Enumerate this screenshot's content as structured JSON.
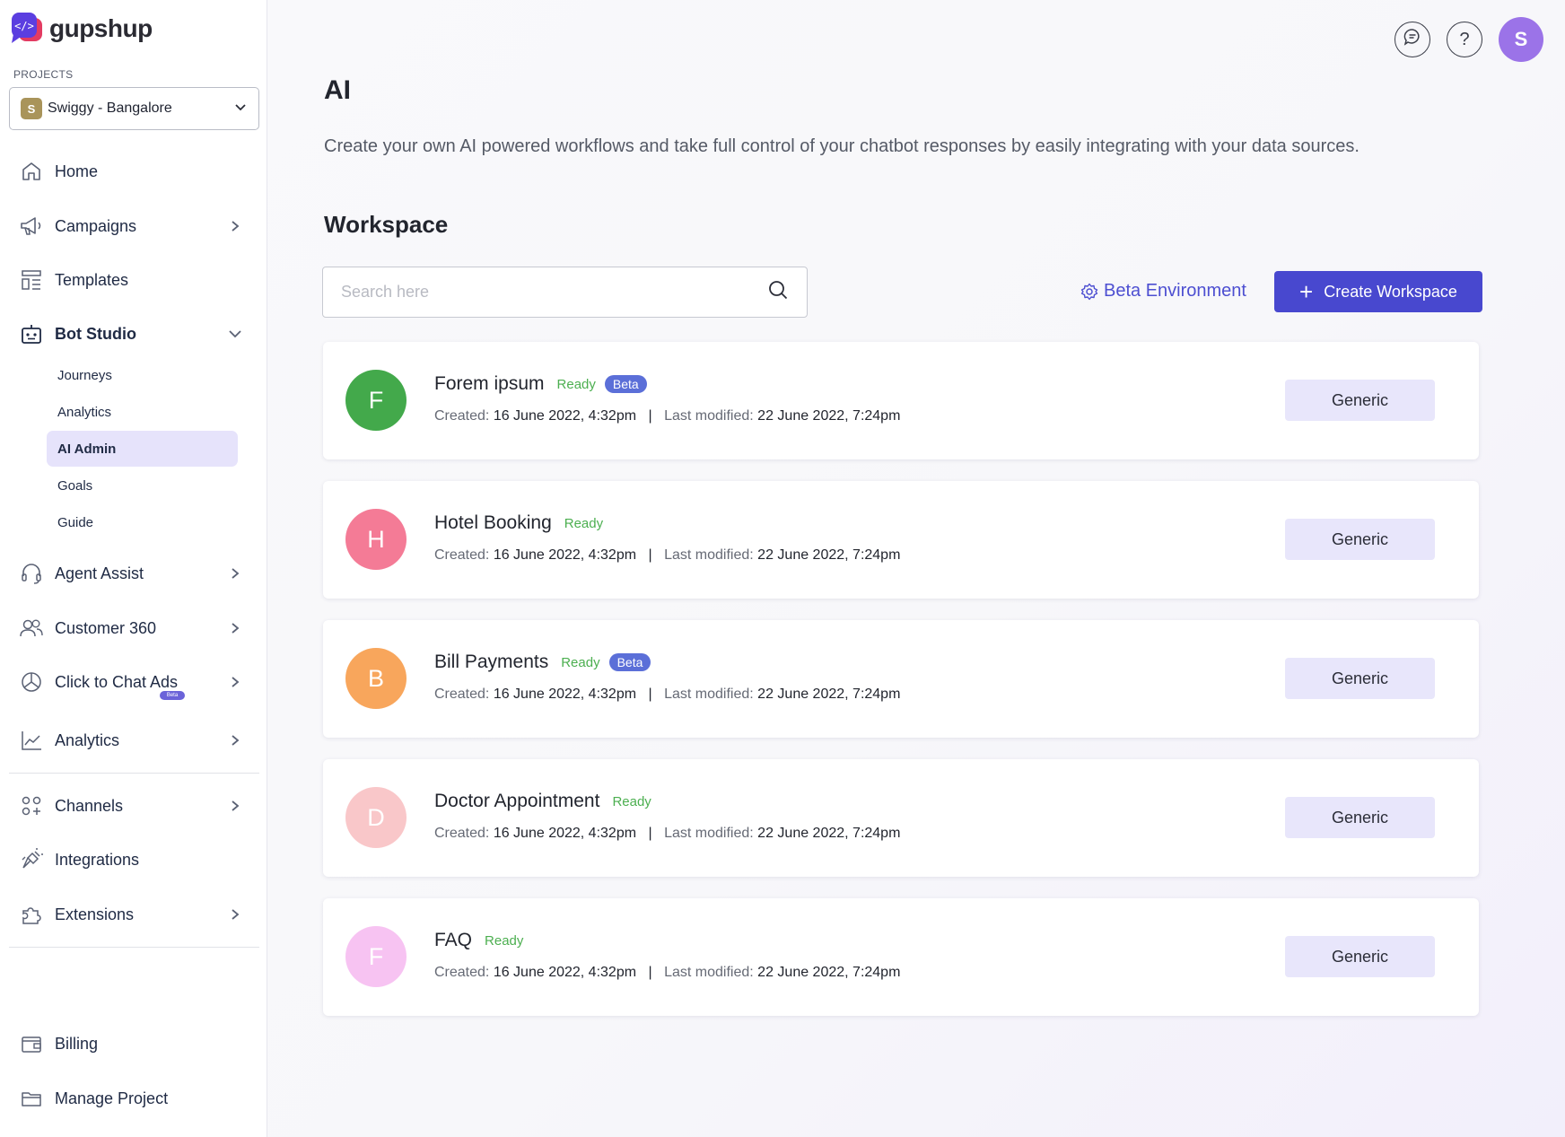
{
  "brand": {
    "name": "gupshup",
    "accent": "#4848cf"
  },
  "projects": {
    "label": "PROJECTS",
    "selected_initial": "S",
    "selected": "Swiggy - Bangalore"
  },
  "nav": {
    "home": "Home",
    "campaigns": "Campaigns",
    "templates": "Templates",
    "bot_studio": "Bot Studio",
    "bot_studio_sub": [
      "Journeys",
      "Analytics",
      "AI Admin",
      "Goals",
      "Guide"
    ],
    "agent_assist": "Agent Assist",
    "customer_360": "Customer 360",
    "click_to_chat_ads": "Click to Chat Ads",
    "click_to_chat_ads_badge": "Beta",
    "analytics": "Analytics",
    "channels": "Channels",
    "integrations": "Integrations",
    "extensions": "Extensions",
    "billing": "Billing",
    "manage_project": "Manage Project"
  },
  "header": {
    "help_symbol": "?",
    "user_initial": "S"
  },
  "page": {
    "title": "AI",
    "description": "Create your own AI powered workflows and take full control of your chatbot responses by easily integrating with your data sources.",
    "section_title": "Workspace"
  },
  "search": {
    "placeholder": "Search here",
    "value": ""
  },
  "actions": {
    "beta_environment": "Beta Environment",
    "create_workspace": "Create Workspace"
  },
  "labels": {
    "created": "Created:",
    "last_modified": "Last modified:",
    "separator": "|"
  },
  "workspaces": [
    {
      "initial": "F",
      "color": "#43a94b",
      "name": "Forem ipsum",
      "status": "Ready",
      "badge": "Beta",
      "created": "16 June 2022, 4:32pm",
      "modified": "22 June 2022, 7:24pm",
      "type": "Generic"
    },
    {
      "initial": "H",
      "color": "#f47b96",
      "name": "Hotel Booking",
      "status": "Ready",
      "badge": "",
      "created": "16 June 2022, 4:32pm",
      "modified": "22 June 2022, 7:24pm",
      "type": "Generic"
    },
    {
      "initial": "B",
      "color": "#f8a65c",
      "name": "Bill Payments",
      "status": "Ready",
      "badge": "Beta",
      "created": "16 June 2022, 4:32pm",
      "modified": "22 June 2022, 7:24pm",
      "type": "Generic"
    },
    {
      "initial": "D",
      "color": "#f9c7c9",
      "name": "Doctor Appointment",
      "status": "Ready",
      "badge": "",
      "created": "16 June 2022, 4:32pm",
      "modified": "22 June 2022, 7:24pm",
      "type": "Generic"
    },
    {
      "initial": "F",
      "color": "#f7c3f2",
      "name": "FAQ",
      "status": "Ready",
      "badge": "",
      "created": "16 June 2022, 4:32pm",
      "modified": "22 June 2022, 7:24pm",
      "type": "Generic"
    }
  ]
}
